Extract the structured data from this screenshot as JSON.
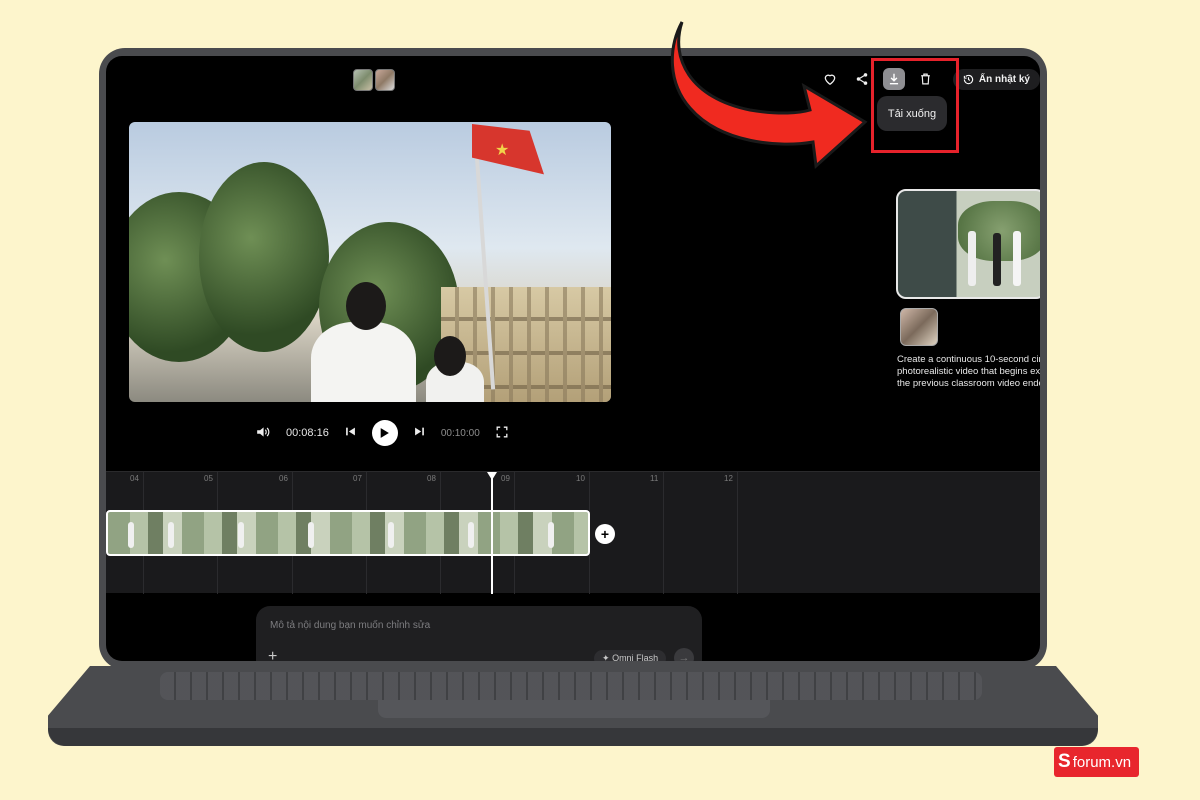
{
  "header": {
    "download_tooltip": "Tải xuống",
    "diary_button": "Ẩn nhật ký",
    "icons": [
      "heart-icon",
      "share-icon",
      "download-icon",
      "trash-icon",
      "history-icon"
    ]
  },
  "player": {
    "current_time": "00:08:16",
    "duration": "00:10:00",
    "icons": [
      "volume-icon",
      "skip-back-icon",
      "play-icon",
      "skip-forward-icon",
      "fullscreen-icon"
    ]
  },
  "side_panel": {
    "prompt_lines": [
      "Create a continuous 10-second cin",
      "photorealistic video that begins exa",
      "the previous classroom video ende"
    ]
  },
  "timeline": {
    "ticks": [
      "04",
      "05",
      "06",
      "07",
      "08",
      "09",
      "10",
      "11",
      "12"
    ],
    "add_clip_label": "+"
  },
  "editor": {
    "placeholder": "Mô tả nội dung bạn muốn chỉnh sửa",
    "add_label": "+",
    "model_label": "Omni Flash"
  },
  "watermark": {
    "brand_letter": "S",
    "brand_text": "forum.vn"
  },
  "colors": {
    "background": "#fdf5cc",
    "highlight_border": "#e6222b",
    "arrow": "#f02a20",
    "laptop_body": "#4a4b4e"
  }
}
